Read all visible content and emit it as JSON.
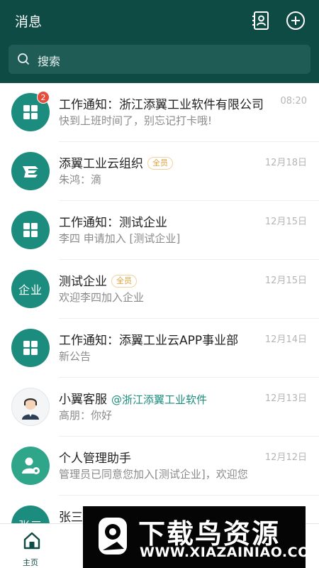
{
  "header": {
    "title": "消息",
    "contacts_icon": "contacts-book-icon",
    "add_icon": "plus-circle-icon"
  },
  "search": {
    "placeholder": "搜索",
    "icon": "search-icon"
  },
  "messages": [
    {
      "name": "工作通知：浙江添翼工业软件有限公司",
      "preview": "快到上班时间了，别忘记打卡哦!",
      "time": "08:20",
      "badge": "2",
      "avatar": "grid-icon"
    },
    {
      "name": "添翼工业云组织",
      "tag": "全员",
      "preview": "朱鸿：滴",
      "time": "12月18日",
      "avatar": "company-logo"
    },
    {
      "name": "工作通知：测试企业",
      "preview": "李四 申请加入 [测试企业]",
      "time": "12月15日",
      "avatar": "grid-icon"
    },
    {
      "name": "测试企业",
      "tag": "全员",
      "preview": "欢迎李四加入企业",
      "time": "12月15日",
      "avatar_text": "企业"
    },
    {
      "name": "工作通知：添翼工业云APP事业部",
      "preview": "新公告",
      "time": "12月14日",
      "avatar": "grid-icon"
    },
    {
      "name": "小翼客服",
      "mention": "@浙江添翼工业软件",
      "preview": "高朋：你好",
      "time": "12月13日",
      "avatar": "customer-service-avatar"
    },
    {
      "name": "个人管理助手",
      "preview": "管理员已同意您加入[测试企业]，欢迎您",
      "time": "12月12日",
      "avatar": "user-gear-icon"
    },
    {
      "name": "张三",
      "avatar_text": "张三"
    }
  ],
  "tabbar": {
    "home_label": "主页"
  },
  "watermark": {
    "title": "下载鸟资源",
    "url": "WWW.XIAZAINIAO.COM"
  },
  "colors": {
    "header_bg": "#0f4b45",
    "accent": "#1b8c7d",
    "badge": "#e64b3c",
    "tag": "#e2a23b"
  }
}
